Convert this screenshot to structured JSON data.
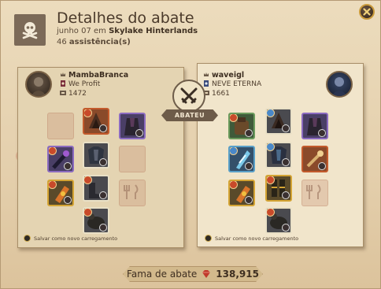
{
  "dialog": {
    "title": "Detalhes do abate",
    "date": "junho 07",
    "em": "em",
    "location": "Skylake Hinterlands",
    "assists_count": "46",
    "assists_label": "assistência(s)"
  },
  "killer": {
    "name": "MambaBranca",
    "guild": "We Profit",
    "item_power": "1472",
    "save_label": "Salvar como novo carregamento"
  },
  "victim": {
    "name": "waveigl",
    "guild": "NEVE ETERNA",
    "item_power": "1661",
    "save_label": "Salvar como novo carregamento"
  },
  "kill_label": "ABATEU",
  "fame": {
    "label": "Fama de abate",
    "value": "138,915"
  },
  "colors": {
    "parchment": "#e9d8b9",
    "fame_icon": "#c0392b",
    "ribbon": "#6d5b49"
  }
}
